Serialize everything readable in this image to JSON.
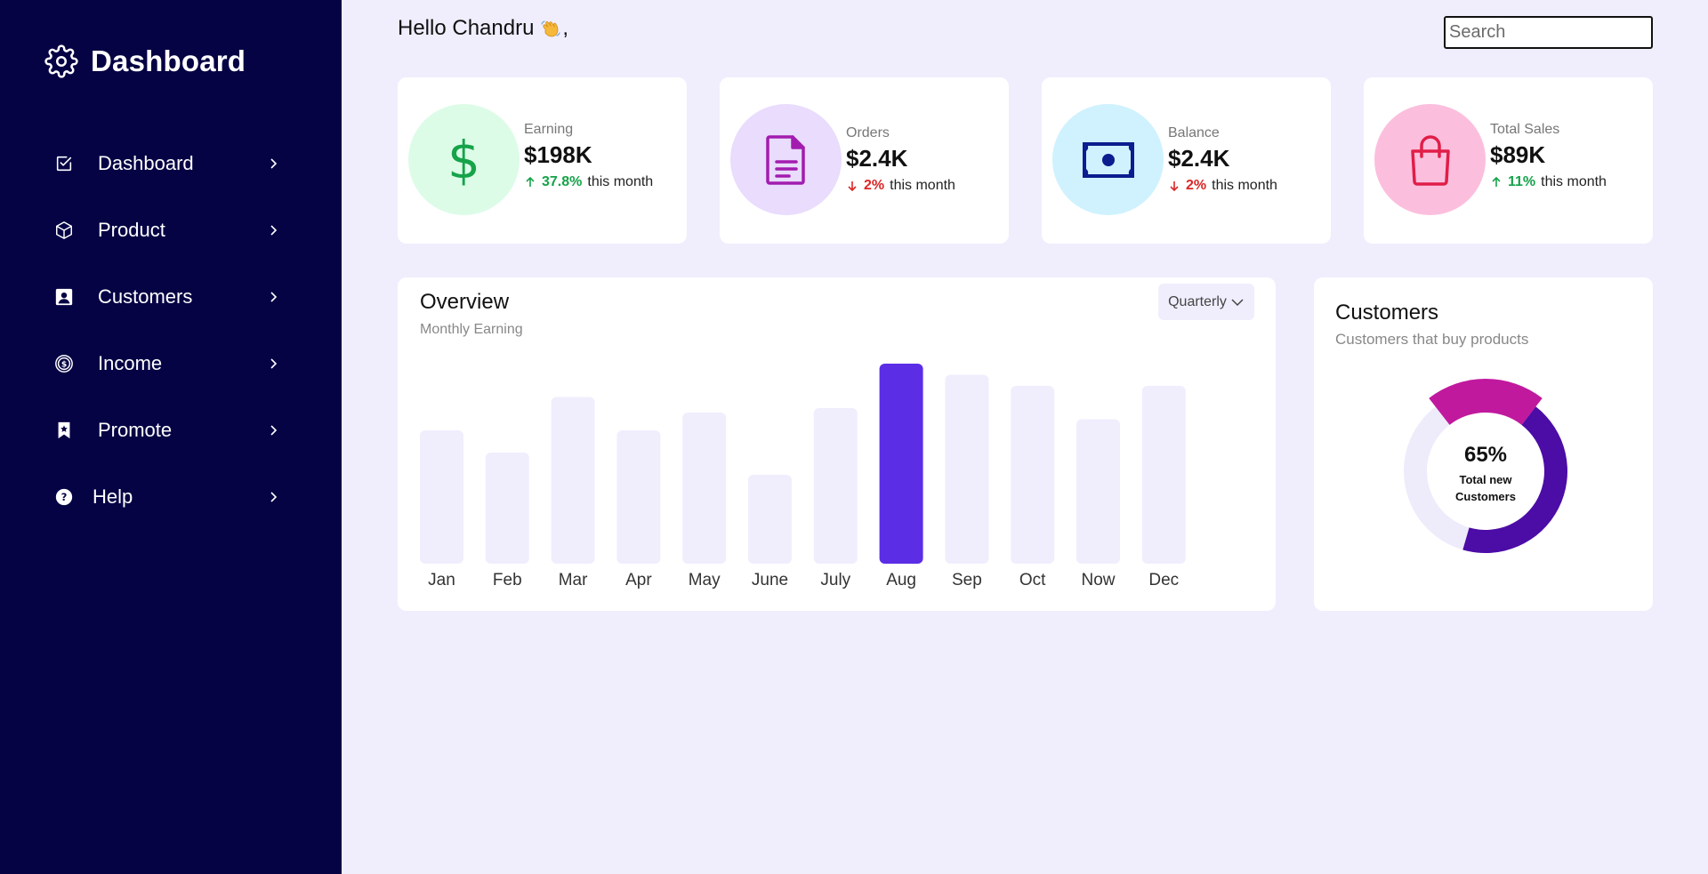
{
  "sidebar": {
    "brand": "Dashboard",
    "items": [
      {
        "label": "Dashboard",
        "icon": "checkbox-icon"
      },
      {
        "label": "Product",
        "icon": "cube-icon"
      },
      {
        "label": "Customers",
        "icon": "user-card-icon"
      },
      {
        "label": "Income",
        "icon": "dollar-coin-icon"
      },
      {
        "label": "Promote",
        "icon": "bookmark-star-icon"
      },
      {
        "label": "Help",
        "icon": "question-icon"
      }
    ]
  },
  "header": {
    "greeting": "Hello Chandru",
    "greeting_suffix": ",",
    "search_placeholder": "Search"
  },
  "stats": [
    {
      "label": "Earning",
      "value": "$198K",
      "pct": "37.8%",
      "trend_text": "this month",
      "direction": "up",
      "circle_color": "#dcfce7",
      "icon": "dollar-icon",
      "icon_color": "#16a34a"
    },
    {
      "label": "Orders",
      "value": "$2.4K",
      "pct": "2%",
      "trend_text": "this month",
      "direction": "down",
      "circle_color": "#e9dcfd",
      "icon": "document-icon",
      "icon_color": "#a21caf"
    },
    {
      "label": "Balance",
      "value": "$2.4K",
      "pct": "2%",
      "trend_text": "this month",
      "direction": "down",
      "circle_color": "#cff2fe",
      "icon": "banknote-icon",
      "icon_color": "#0c1d8f"
    },
    {
      "label": "Total Sales",
      "value": "$89K",
      "pct": "11%",
      "trend_text": "this month",
      "direction": "up",
      "circle_color": "#fbbfdd",
      "icon": "shopping-bag-icon",
      "icon_color": "#e11d48"
    }
  ],
  "overview": {
    "title": "Overview",
    "subtitle": "Monthly Earning",
    "period": "Quarterly"
  },
  "chart_data": {
    "type": "bar",
    "categories": [
      "Jan",
      "Feb",
      "Mar",
      "Apr",
      "May",
      "June",
      "July",
      "Aug",
      "Sep",
      "Oct",
      "Now",
      "Dec"
    ],
    "values": [
      60,
      50,
      75,
      60,
      68,
      40,
      70,
      90,
      85,
      80,
      65,
      80
    ],
    "highlight": "Aug",
    "bar_color": "#f0eefd",
    "highlight_color": "#5b2ee6",
    "ylim": [
      0,
      90
    ]
  },
  "customers": {
    "title": "Customers",
    "subtitle": "Customers that buy products",
    "percent": "65%",
    "label": "Total new Customers",
    "segments": {
      "highlight_fraction": 0.21,
      "main_fraction": 0.44,
      "highlight_color": "#c0199e",
      "main_color": "#4c0ca6",
      "track_color": "#eeebfb"
    }
  }
}
